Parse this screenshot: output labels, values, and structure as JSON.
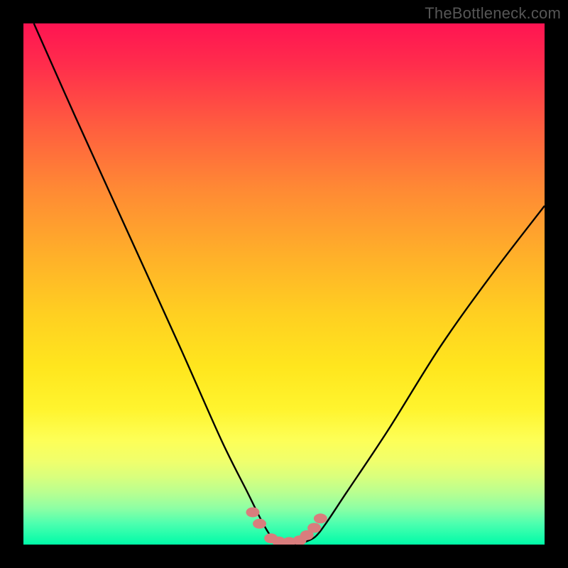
{
  "watermark": "TheBottleneck.com",
  "chart_data": {
    "type": "line",
    "title": "",
    "xlabel": "",
    "ylabel": "",
    "xlim": [
      0,
      100
    ],
    "ylim": [
      0,
      100
    ],
    "grid": false,
    "legend": false,
    "annotations": [],
    "series": [
      {
        "name": "bottleneck-curve",
        "x": [
          2,
          10,
          20,
          30,
          38,
          43,
          46,
          48,
          50,
          52,
          54,
          56,
          58,
          62,
          70,
          80,
          90,
          100
        ],
        "y": [
          100,
          82,
          60,
          38,
          20,
          10,
          4,
          1,
          0,
          0,
          0.5,
          1.5,
          4,
          10,
          22,
          38,
          52,
          65
        ],
        "color": "#000000"
      }
    ],
    "highlight_points": {
      "name": "flat-segment-dots",
      "color": "#d97d7d",
      "x": [
        44.0,
        45.3,
        47.5,
        49.0,
        51.0,
        53.0,
        54.4,
        55.8,
        57.0
      ],
      "y": [
        6.2,
        4.0,
        1.2,
        0.6,
        0.5,
        0.8,
        1.8,
        3.2,
        5.0
      ]
    },
    "gradient_stops": [
      {
        "pct": 0,
        "color": "#ff1452"
      },
      {
        "pct": 8,
        "color": "#ff2d4c"
      },
      {
        "pct": 20,
        "color": "#ff5e3f"
      },
      {
        "pct": 32,
        "color": "#ff8a34"
      },
      {
        "pct": 45,
        "color": "#ffb129"
      },
      {
        "pct": 56,
        "color": "#ffd021"
      },
      {
        "pct": 66,
        "color": "#ffe61e"
      },
      {
        "pct": 74,
        "color": "#fff42e"
      },
      {
        "pct": 80,
        "color": "#fdff57"
      },
      {
        "pct": 84,
        "color": "#f0ff6c"
      },
      {
        "pct": 87,
        "color": "#d9ff7d"
      },
      {
        "pct": 90,
        "color": "#b9ff90"
      },
      {
        "pct": 93,
        "color": "#8effa4"
      },
      {
        "pct": 96,
        "color": "#4cffaf"
      },
      {
        "pct": 100,
        "color": "#00fba8"
      }
    ]
  }
}
